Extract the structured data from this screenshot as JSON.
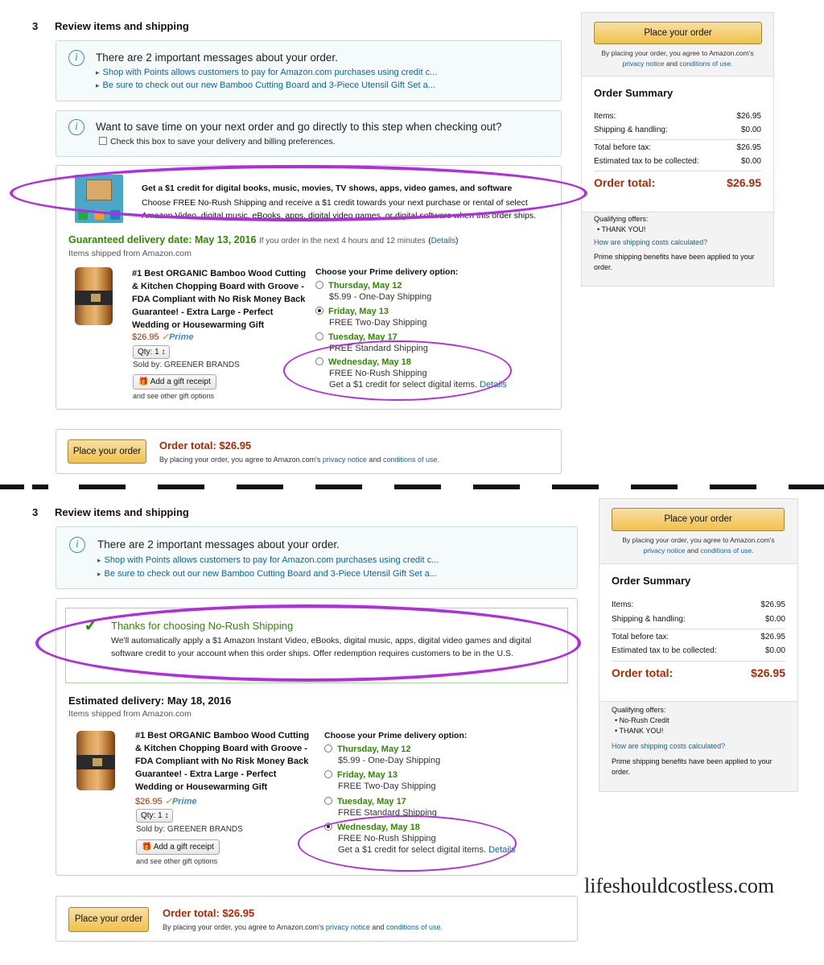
{
  "step": {
    "number": "3",
    "title": "Review items and shipping"
  },
  "important": {
    "heading": "There are 2 important messages about your order.",
    "links": [
      "Shop with Points allows customers to pay for Amazon.com purchases using credit c...",
      "Be sure to check out our new Bamboo Cutting Board and 3-Piece Utensil Gift Set a..."
    ]
  },
  "save_time": {
    "heading": "Want to save time on your next order and go directly to this step when checking out?",
    "checkbox_label": "Check this box to save your delivery and billing preferences."
  },
  "promo": {
    "title": "Get a $1 credit for digital books, music, movies, TV shows, apps, video games, and software",
    "body": "Choose FREE No-Rush Shipping and receive a $1 credit towards your next purchase or rental of select Amazon Video, digital music, eBooks, apps, digital video games, or digital software when this order ships."
  },
  "top": {
    "delivery_label": "Guaranteed delivery date:",
    "delivery_date": "May 13, 2016",
    "delivery_note": "If you order in the next 4 hours and 12 minutes",
    "details_link": "Details",
    "shipped_from": "Items shipped from Amazon.com"
  },
  "thanks": {
    "title": "Thanks for choosing No-Rush Shipping",
    "body": "We'll automatically apply a $1 Amazon Instant Video, eBooks, digital music, apps, digital video games and digital software credit to your account when this order ships. Offer redemption requires customers to be in the U.S."
  },
  "bottom": {
    "delivery_label": "Estimated delivery:",
    "delivery_date": "May 18, 2016",
    "shipped_from": "Items shipped from Amazon.com"
  },
  "product": {
    "title": "#1 Best ORGANIC Bamboo Wood Cutting & Kitchen Chopping Board with Groove - FDA Compliant with No Risk Money Back Guarantee! - Extra Large - Perfect Wedding or Housewarming Gift",
    "price": "$26.95",
    "prime": "Prime",
    "qty": "Qty:  1",
    "sold_by": "Sold by: GREENER BRANDS",
    "gift_button": "Add a gift receipt",
    "gift_options": "and see other gift options"
  },
  "delivery_options": {
    "heading": "Choose your Prime delivery option:",
    "options": [
      {
        "date": "Thursday, May 12",
        "desc": "$5.99 - One-Day Shipping"
      },
      {
        "date": "Friday, May 13",
        "desc": "FREE Two-Day Shipping"
      },
      {
        "date": "Tuesday, May 17",
        "desc": "FREE Standard Shipping"
      },
      {
        "date": "Wednesday, May 18",
        "desc": "FREE No-Rush Shipping",
        "extra": "Get a $1 credit for select digital items.",
        "extra_link": "Details"
      }
    ],
    "selected_top": 1,
    "selected_bottom": 3
  },
  "footer_order": {
    "button": "Place your order",
    "total": "Order total: $26.95",
    "agree_prefix": "By placing your order, you agree to Amazon.com's",
    "privacy": "privacy notice",
    "and": "and",
    "conditions": "conditions of use."
  },
  "sidebar": {
    "button": "Place your order",
    "agree_line1": "By placing your order, you agree to Amazon.com's",
    "privacy": "privacy notice",
    "and": "and",
    "conditions": "conditions of use.",
    "summary_title": "Order Summary",
    "rows": [
      {
        "label": "Items:",
        "value": "$26.95"
      },
      {
        "label": "Shipping & handling:",
        "value": "$0.00"
      },
      {
        "label": "Total before tax:",
        "value": "$26.95"
      },
      {
        "label": "Estimated tax to be collected:",
        "value": "$0.00"
      }
    ],
    "total_label": "Order total:",
    "total_value": "$26.95",
    "qualifying": "Qualifying offers:",
    "offers_top": [
      "THANK YOU!"
    ],
    "offers_bottom": [
      "No-Rush Credit",
      "THANK YOU!"
    ],
    "shipping_link": "How are shipping costs calculated?",
    "prime_note": "Prime shipping benefits have been applied to your order."
  },
  "watermark": "lifeshouldcostless.com",
  "colors": {
    "accent_green": "#2e8b00",
    "price_red": "#b12704",
    "link_blue": "#0a66a8",
    "highlight_purple": "#b12de0"
  }
}
